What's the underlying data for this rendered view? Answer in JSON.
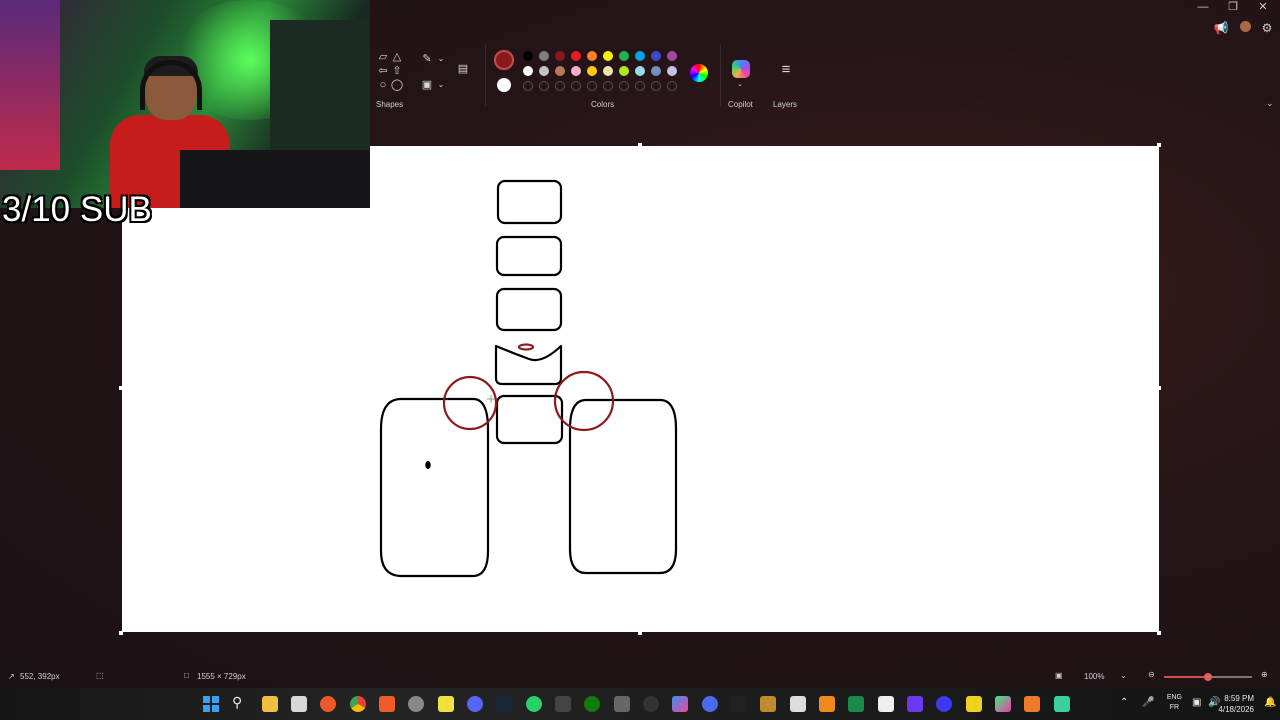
{
  "stream_overlay": {
    "sub_goal": "3/10 SUB"
  },
  "window": {
    "minimize_icon": "minimize-icon",
    "restore_icon": "restore-icon",
    "close_icon": "close-icon"
  },
  "ribbon": {
    "shapes_label": "Shapes",
    "colors_label": "Colors",
    "copilot_label": "Copilot",
    "layers_label": "Layers",
    "active_color_primary": "#8b1a1a",
    "active_color_secondary": "#ffffff",
    "palette_row_1": [
      "#000000",
      "#7f7f7f",
      "#8b1a1a",
      "#ed1c24",
      "#ff7f27",
      "#fff200",
      "#22b14c",
      "#00a2e8",
      "#3f48cc",
      "#a349a4"
    ],
    "palette_row_2": [
      "#ffffff",
      "#c3c3c3",
      "#b97a57",
      "#ffaec9",
      "#ffc90e",
      "#efe4b0",
      "#b5e61d",
      "#99d9ea",
      "#7092be",
      "#c8bfe7"
    ]
  },
  "status": {
    "cursor_position": "552, 392px",
    "canvas_size": "1555 × 729px",
    "zoom": "100%",
    "zoom_fraction": 0.5
  },
  "taskbar": {
    "lang_primary": "ENG",
    "lang_secondary": "FR",
    "time": "8:59 PM",
    "date": "4/18/2026"
  }
}
